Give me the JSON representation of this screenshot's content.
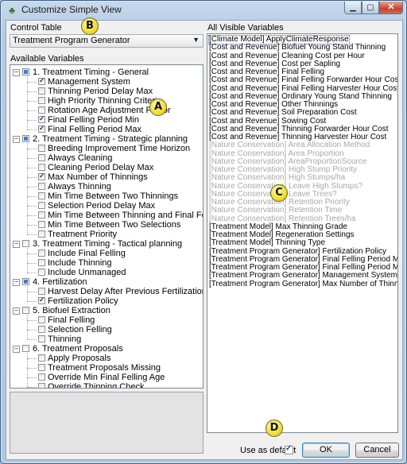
{
  "window": {
    "title": "Customize Simple View",
    "min_glyph": "▁",
    "max_glyph": "▢",
    "close_glyph": "✕"
  },
  "control_table": {
    "label": "Control Table",
    "selected": "Treatment Program Generator"
  },
  "available": {
    "label": "Available Variables",
    "groups": [
      {
        "label": "1. Treatment Timing - General",
        "state": "partial",
        "expanded": true,
        "items": [
          {
            "label": "Management System",
            "checked": true
          },
          {
            "label": "Thinning Period Delay Max",
            "checked": false
          },
          {
            "label": "High Priority Thinning Criteria",
            "checked": false
          },
          {
            "label": "Rotation Age Adjustment Factor",
            "checked": false
          },
          {
            "label": "Final Felling Period Min",
            "checked": true
          },
          {
            "label": "Final Felling Period Max",
            "checked": true
          }
        ]
      },
      {
        "label": "2. Treatment Timing - Strategic planning",
        "state": "partial",
        "expanded": true,
        "items": [
          {
            "label": "Breeding Improvement Time Horizon",
            "checked": false
          },
          {
            "label": "Always Cleaning",
            "checked": false
          },
          {
            "label": "Cleaning Period Delay Max",
            "checked": false
          },
          {
            "label": "Max Number of Thinnings",
            "checked": true
          },
          {
            "label": "Always Thinning",
            "checked": false
          },
          {
            "label": "Min Time Between Two Thinnings",
            "checked": false
          },
          {
            "label": "Selection Period Delay Max",
            "checked": false
          },
          {
            "label": "Min Time Between Thinning and Final Felling",
            "checked": false
          },
          {
            "label": "Min Time Between Two Selections",
            "checked": false
          },
          {
            "label": "Treatment Priority",
            "checked": false
          }
        ]
      },
      {
        "label": "3. Treatment Timing - Tactical planning",
        "state": "none",
        "expanded": true,
        "items": [
          {
            "label": "Include Final Felling",
            "checked": false
          },
          {
            "label": "Include Thinning",
            "checked": false
          },
          {
            "label": "Include Unmanaged",
            "checked": false
          }
        ]
      },
      {
        "label": "4. Fertilization",
        "state": "partial",
        "expanded": true,
        "items": [
          {
            "label": "Harvest Delay After Previous Fertilization",
            "checked": false
          },
          {
            "label": "Fertilization Policy",
            "checked": true
          }
        ]
      },
      {
        "label": "5. Biofuel Extraction",
        "state": "none",
        "expanded": true,
        "items": [
          {
            "label": "Final Felling",
            "checked": false
          },
          {
            "label": "Selection Felling",
            "checked": false
          },
          {
            "label": "Thinning",
            "checked": false
          }
        ]
      },
      {
        "label": "6. Treatment Proposals",
        "state": "none",
        "expanded": true,
        "items": [
          {
            "label": "Apply Proposals",
            "checked": false
          },
          {
            "label": "Treatment Proposals Missing",
            "checked": false
          },
          {
            "label": "Override Min Final Felling Age",
            "checked": false
          },
          {
            "label": "Override Thinning Check",
            "checked": false
          }
        ]
      }
    ]
  },
  "visible": {
    "label": "All Visible Variables",
    "items": [
      {
        "text": "[Climate Model] ApplyClimateResponse",
        "grey": false,
        "selected": true
      },
      {
        "text": "[Cost and Revenue] Biofuel Young Stand Thinning",
        "grey": false
      },
      {
        "text": "[Cost and Revenue] Cleaning Cost per Hour",
        "grey": false
      },
      {
        "text": "[Cost and Revenue] Cost per Sapling",
        "grey": false
      },
      {
        "text": "[Cost and Revenue] Final Felling",
        "grey": false
      },
      {
        "text": "[Cost and Revenue] Final Felling Forwarder Hour Cost",
        "grey": false
      },
      {
        "text": "[Cost and Revenue] Final Felling Harvester Hour Cost",
        "grey": false
      },
      {
        "text": "[Cost and Revenue] Ordinary Young Stand Thinning",
        "grey": false
      },
      {
        "text": "[Cost and Revenue] Other Thinnings",
        "grey": false
      },
      {
        "text": "[Cost and Revenue] Soil Preparation Cost",
        "grey": false
      },
      {
        "text": "[Cost and Revenue] Sowing Cost",
        "grey": false
      },
      {
        "text": "[Cost and Revenue] Thinning Forwarder Hour Cost",
        "grey": false
      },
      {
        "text": "[Cost and Revenue] Thinning Harvester Hour Cost",
        "grey": false
      },
      {
        "text": "[Nature Conservation] Area Allocation Method",
        "grey": true
      },
      {
        "text": "[Nature Conservation] Area Proportion",
        "grey": true
      },
      {
        "text": "[Nature Conservation] AreaProportionSource",
        "grey": true
      },
      {
        "text": "[Nature Conservation] High Stump Priority",
        "grey": true
      },
      {
        "text": "[Nature Conservation] High Stumps/ha",
        "grey": true
      },
      {
        "text": "[Nature Conservation] Leave High Stumps?",
        "grey": true
      },
      {
        "text": "[Nature Conservation] Leave Trees?",
        "grey": true
      },
      {
        "text": "[Nature Conservation] Retention Priority",
        "grey": true
      },
      {
        "text": "[Nature Conservation] Retention Time",
        "grey": true
      },
      {
        "text": "[Nature Conservation] Retention Trees/ha",
        "grey": true
      },
      {
        "text": "[Treatment Model] Max Thinning Grade",
        "grey": false
      },
      {
        "text": "[Treatment Model] Regeneration Settings",
        "grey": false
      },
      {
        "text": "[Treatment Model] Thinning Type",
        "grey": false
      },
      {
        "text": "[Treatment Program Generator] Fertilization Policy",
        "grey": false
      },
      {
        "text": "[Treatment Program Generator] Final Felling Period Max",
        "grey": false
      },
      {
        "text": "[Treatment Program Generator] Final Felling Period Min",
        "grey": false
      },
      {
        "text": "[Treatment Program Generator] Management System",
        "grey": false
      },
      {
        "text": "[Treatment Program Generator] Max Number of Thinnings",
        "grey": false
      }
    ]
  },
  "footer": {
    "use_as_default_label": "Use as default",
    "use_as_default_checked": true,
    "ok_label": "OK",
    "cancel_label": "Cancel"
  },
  "callouts": {
    "a": "A",
    "b": "B",
    "c": "C",
    "d": "D"
  }
}
